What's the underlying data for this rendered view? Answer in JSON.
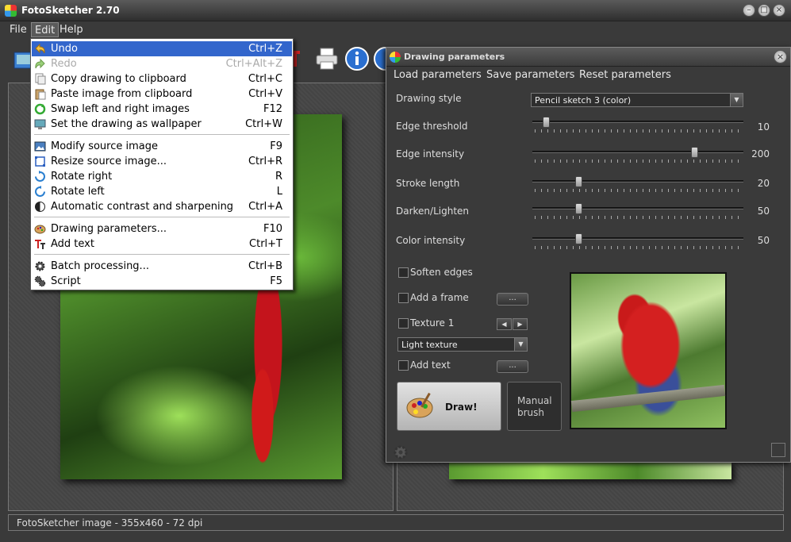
{
  "window": {
    "title": "FotoSketcher 2.70",
    "buttons": [
      "minimize",
      "maximize",
      "close"
    ]
  },
  "menubar": {
    "items": [
      {
        "label": "File"
      },
      {
        "label": "Edit"
      },
      {
        "label": "Help"
      }
    ]
  },
  "edit_menu": {
    "items": [
      {
        "icon": "undo-icon",
        "label": "Undo",
        "shortcut": "Ctrl+Z",
        "state": "highlighted"
      },
      {
        "icon": "redo-icon",
        "label": "Redo",
        "shortcut": "Ctrl+Alt+Z",
        "state": "disabled"
      },
      {
        "icon": "copy-icon",
        "label": "Copy drawing to clipboard",
        "shortcut": "Ctrl+C"
      },
      {
        "icon": "paste-icon",
        "label": "Paste image from clipboard",
        "shortcut": "Ctrl+V"
      },
      {
        "icon": "swap-icon",
        "label": "Swap left and right images",
        "shortcut": "F12"
      },
      {
        "icon": "wallpaper-icon",
        "label": "Set the drawing as wallpaper",
        "shortcut": "Ctrl+W"
      },
      {
        "icon": "modify-image-icon",
        "label": "Modify source image",
        "shortcut": "F9"
      },
      {
        "icon": "resize-icon",
        "label": "Resize source image...",
        "shortcut": "Ctrl+R"
      },
      {
        "icon": "rotate-right-icon",
        "label": "Rotate right",
        "shortcut": "R"
      },
      {
        "icon": "rotate-left-icon",
        "label": "Rotate left",
        "shortcut": "L"
      },
      {
        "icon": "contrast-icon",
        "label": "Automatic contrast and sharpening",
        "shortcut": "Ctrl+A"
      },
      {
        "icon": "palette-icon",
        "label": "Drawing parameters...",
        "shortcut": "F10"
      },
      {
        "icon": "text-icon",
        "label": "Add text",
        "shortcut": "Ctrl+T"
      },
      {
        "icon": "batch-gear-icon",
        "label": "Batch processing...",
        "shortcut": "Ctrl+B"
      },
      {
        "icon": "script-gear-icon",
        "label": "Script",
        "shortcut": "F5"
      }
    ]
  },
  "status": {
    "text": "FotoSketcher image - 355x460 - 72 dpi"
  },
  "dialog": {
    "title": "Drawing parameters",
    "menu": [
      "Load parameters",
      "Save parameters",
      "Reset parameters"
    ],
    "drawing_style": {
      "label": "Drawing style",
      "value": "Pencil sketch 3 (color)"
    },
    "sliders": [
      {
        "label": "Edge threshold",
        "value": "10",
        "fraction": 0.05
      },
      {
        "label": "Edge intensity",
        "value": "200",
        "fraction": 0.78
      },
      {
        "label": "Stroke length",
        "value": "20",
        "fraction": 0.21
      },
      {
        "label": "Darken/Lighten",
        "value": "50",
        "fraction": 0.21
      },
      {
        "label": "Color intensity",
        "value": "50",
        "fraction": 0.21
      }
    ],
    "options": {
      "soften_edges": "Soften edges",
      "add_frame": "Add a frame",
      "texture": "Texture 1",
      "texture_combo": "Light texture",
      "add_text": "Add text",
      "dots": "..."
    },
    "draw_button": "Draw!",
    "manual_brush_button": "Manual brush"
  },
  "colors": {
    "menu_highlight": "#3366cc",
    "window_bg": "#3a3a3a"
  }
}
